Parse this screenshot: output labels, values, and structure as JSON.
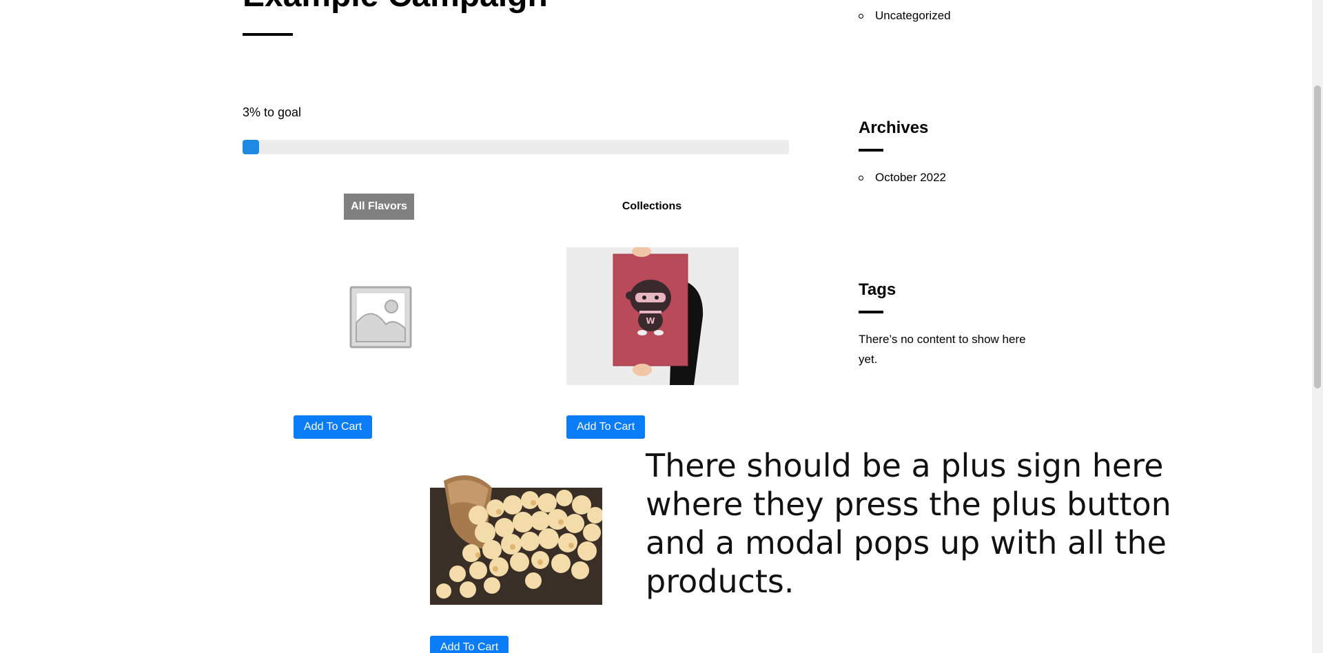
{
  "campaign": {
    "title": "Example Campaign",
    "goal_text": "3% to goal",
    "progress_percent": 3
  },
  "tabs": [
    {
      "label": "All Flavors",
      "active": true
    },
    {
      "label": "Collections",
      "active": false
    }
  ],
  "products": [
    {
      "image": "placeholder-image",
      "button_label": "Add To Cart"
    },
    {
      "image": "ninja-poster-image",
      "button_label": "Add To Cart"
    },
    {
      "image": "popcorn-image",
      "button_label": "Add To Cart"
    }
  ],
  "annotation": "There should be a plus sign here where they press the plus button and a modal pops up with all the products.",
  "sidebar": {
    "categories": {
      "items": [
        "Uncategorized"
      ]
    },
    "archives": {
      "heading": "Archives",
      "items": [
        "October 2022"
      ]
    },
    "tags": {
      "heading": "Tags",
      "empty_text": "There’s no content to show here yet."
    }
  },
  "colors": {
    "accent": "#0a7cf5",
    "progress": "#1e88e5",
    "active_tab": "#808080"
  }
}
